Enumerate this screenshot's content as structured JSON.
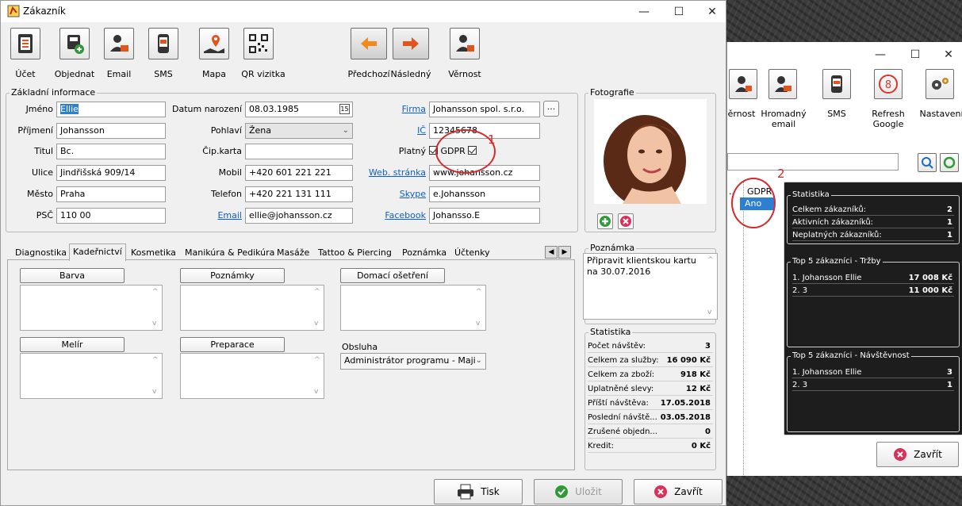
{
  "window": {
    "title": "Zákazník",
    "controls": {
      "minimize": "—",
      "maximize": "☐",
      "close": "✕"
    }
  },
  "toolbar": {
    "items": [
      {
        "label": "Účet",
        "icon": "document-icon"
      },
      {
        "label": "Objednat",
        "icon": "register-add-icon"
      },
      {
        "label": "Email",
        "icon": "user-email-icon"
      },
      {
        "label": "SMS",
        "icon": "phone-sms-icon"
      },
      {
        "label": "Mapa",
        "icon": "map-pin-icon"
      },
      {
        "label": "QR vizitka",
        "icon": "qr-code-icon"
      },
      {
        "label": "Předchozí",
        "icon": "arrow-left-icon"
      },
      {
        "label": "Následný",
        "icon": "arrow-right-icon"
      },
      {
        "label": "Věrnost",
        "icon": "loyalty-user-icon"
      }
    ]
  },
  "basic_info": {
    "caption": "Základní informace",
    "jmeno": {
      "label": "Jméno",
      "value": "Ellie"
    },
    "prijmeni": {
      "label": "Příjmení",
      "value": "Johansson"
    },
    "titul": {
      "label": "Titul",
      "value": "Bc."
    },
    "ulice": {
      "label": "Ulice",
      "value": "Jindřišská 909/14"
    },
    "mesto": {
      "label": "Město",
      "value": "Praha"
    },
    "psc": {
      "label": "PSČ",
      "value": "110 00"
    },
    "datum": {
      "label": "Datum narození",
      "value": "08.03.1985"
    },
    "pohlavi": {
      "label": "Pohlaví",
      "value": "Žena"
    },
    "cip": {
      "label": "Čip.karta",
      "value": ""
    },
    "mobil": {
      "label": "Mobil",
      "value": "+420 601 221 221"
    },
    "telefon": {
      "label": "Telefon",
      "value": "+420 221 131 111"
    },
    "email": {
      "label": "Email",
      "value": "ellie@johansson.cz"
    },
    "firma": {
      "label": "Firma",
      "value": "Johansson spol. s.r.o."
    },
    "ic": {
      "label": "IČ",
      "value": "12345678"
    },
    "platny": {
      "label": "Platný",
      "gdpr": "GDPR"
    },
    "web": {
      "label": "Web. stránka",
      "value": "www.johansson.cz"
    },
    "skype": {
      "label": "Skype",
      "value": "e.Johansson"
    },
    "facebook": {
      "label": "Facebook",
      "value": "Johansso.E"
    },
    "more_button": "..."
  },
  "photo": {
    "caption": "Fotografie"
  },
  "tabs": [
    {
      "label": "Diagnostika"
    },
    {
      "label": "Kadeřnictví",
      "active": true
    },
    {
      "label": "Kosmetika"
    },
    {
      "label": "Manikúra & Pedikúra"
    },
    {
      "label": "Masáže"
    },
    {
      "label": "Tattoo & Piercing"
    },
    {
      "label": "Poznámka"
    },
    {
      "label": "Účtenky"
    }
  ],
  "tab_content": {
    "barva": "Barva",
    "poznamky": "Poznámky",
    "domaci": "Domací ošetření",
    "melir": "Melír",
    "preparace": "Preparace",
    "obsluha_label": "Obsluha",
    "obsluha_value": "Administrátor programu - Majit"
  },
  "note": {
    "caption": "Poznámka",
    "text": "Připravit klientskou kartu na 30.07.2016"
  },
  "stats": {
    "caption": "Statistika",
    "rows": [
      {
        "label": "Počet návštěv:",
        "value": "3"
      },
      {
        "label": "Celkem za služby:",
        "value": "16 090 Kč"
      },
      {
        "label": "Celkem za zboží:",
        "value": "918 Kč"
      },
      {
        "label": "Uplatněné slevy:",
        "value": "12 Kč"
      },
      {
        "label": "Příští návštěva:",
        "value": "17.05.2018"
      },
      {
        "label": "Poslední návště...",
        "value": "03.05.2018"
      },
      {
        "label": "Zrušené objedn...",
        "value": "0"
      },
      {
        "label": "Kredit:",
        "value": "0 Kč"
      }
    ]
  },
  "bottom_buttons": {
    "print": "Tisk",
    "save": "Uložit",
    "close": "Zavřít"
  },
  "annotations": {
    "one": "1",
    "two": "2"
  },
  "back_window": {
    "controls": {
      "minimize": "—",
      "maximize": "☐",
      "close": "✕"
    },
    "toolbar": [
      {
        "label": "ěrnost"
      },
      {
        "label": "Hromadný email"
      },
      {
        "label": "SMS"
      },
      {
        "label": "Refresh Google"
      },
      {
        "label": "Nastavení"
      }
    ],
    "list": {
      "dots": "..",
      "header": "GDPR",
      "value": "Ano"
    },
    "stats": {
      "caption": "Statistika",
      "rows": [
        {
          "label": "Celkem zákazníků:",
          "value": "2"
        },
        {
          "label": "Aktivních zákazníků:",
          "value": "1"
        },
        {
          "label": "Neplatných zákazníků:",
          "value": "1"
        }
      ]
    },
    "top_revenue": {
      "caption": "Top 5 zákazníci - Tržby",
      "rows": [
        {
          "label": "1. Johansson Ellie",
          "value": "17 008 Kč"
        },
        {
          "label": "2. 3",
          "value": "11 000 Kč"
        }
      ]
    },
    "top_visits": {
      "caption": "Top 5 zákazníci - Návštěvnost",
      "rows": [
        {
          "label": "1. Johansson Ellie",
          "value": "3"
        },
        {
          "label": "2. 3",
          "value": "1"
        }
      ]
    },
    "close_button": "Zavřít"
  },
  "colors": {
    "accent_link": "#0b5fcc",
    "annotation": "#d42a2a",
    "dark_panel": "#1d1d1d"
  }
}
